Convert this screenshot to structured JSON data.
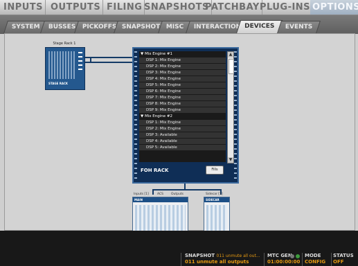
{
  "top_tabs": [
    "INPUTS",
    "OUTPUTS",
    "FILING",
    "SNAPSHOTS",
    "PATCHBAY",
    "PLUG-INS",
    "OPTIONS"
  ],
  "sub_tabs": [
    "SYSTEM",
    "BUSSES",
    "PICKOFFS",
    "SNAPSHOTS",
    "MISC",
    "INTERACTION",
    "DEVICES",
    "EVENTS"
  ],
  "stage_rack": {
    "title": "Stage Rack 1",
    "label": "STAGE RACK"
  },
  "foh": {
    "items": [
      {
        "t": "▼ Mix Engine #1",
        "hdr": true
      },
      {
        "t": "DSP 1: Mix Engine"
      },
      {
        "t": "DSP 2: Mix Engine"
      },
      {
        "t": "DSP 3: Mix Engine"
      },
      {
        "t": "DSP 4: Mix Engine"
      },
      {
        "t": "DSP 5: Mix Engine"
      },
      {
        "t": "DSP 6: Mix Engine"
      },
      {
        "t": "DSP 7: Mix Engine"
      },
      {
        "t": "DSP 8: Mix Engine"
      },
      {
        "t": "DSP 9: Mix Engine"
      },
      {
        "t": "▼ Mix Engine #2",
        "hdr": true
      },
      {
        "t": "DSP 1: Mix Engine"
      },
      {
        "t": "DSP 2: Mix Engine"
      },
      {
        "t": "DSP 3: Available"
      },
      {
        "t": "DSP 4: Available"
      },
      {
        "t": "DSP 5: Available"
      }
    ],
    "label": "FOH RACK",
    "button": "Fills"
  },
  "main_unit": {
    "caps": [
      "Inputs [1]",
      "ACS",
      "Outputs"
    ],
    "head": "MAIN"
  },
  "sidecar": {
    "cap": "Sidecar [1]",
    "head": "SIDECAR"
  },
  "status": {
    "snapshot_label": "SNAPSHOT",
    "snapshot_inline": "011 unmute all out...",
    "snapshot_value": "011 unmute all outputs",
    "mtc_label": "MTC GEN",
    "mtc_value": "01:00:00:00",
    "mode_label": "MODE",
    "mode_value": "CONFIG",
    "status_label": "STATUS",
    "status_value": "OFF"
  }
}
